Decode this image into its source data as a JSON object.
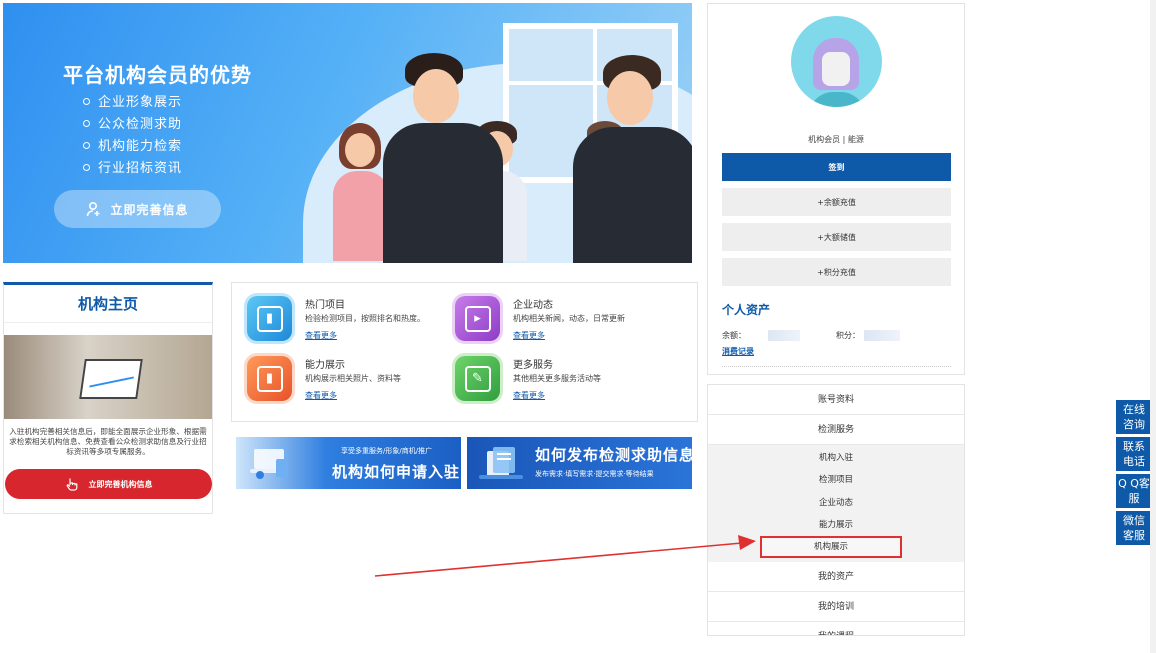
{
  "hero": {
    "title": "平台机构会员的优势",
    "points": [
      "企业形象展示",
      "公众检测求助",
      "机构能力检索",
      "行业招标资讯"
    ],
    "button": "立即完善信息"
  },
  "org_card": {
    "title": "机构主页",
    "description": "入驻机构完善相关信息后，即能全面展示企业形象、根据需求检索相关机构信息、免费查看公众检测求助信息及行业招标资讯等多项专属服务。",
    "button": "立即完善机构信息"
  },
  "services": [
    {
      "title": "热门项目",
      "desc": "检验检测项目，按照排名和热度。",
      "more": "查看更多",
      "icon": "book-icon",
      "color": "#29a3e6"
    },
    {
      "title": "企业动态",
      "desc": "机构相关新闻，动态，日常更新",
      "more": "查看更多",
      "icon": "video-icon",
      "color": "#a24fd1"
    },
    {
      "title": "能力展示",
      "desc": "机构展示相关照片、资料等",
      "more": "查看更多",
      "icon": "book-icon",
      "color": "#f06a3c"
    },
    {
      "title": "更多服务",
      "desc": "其他相关更多服务活动等",
      "more": "查看更多",
      "icon": "edit-icon",
      "color": "#3cb84a"
    }
  ],
  "promos": [
    {
      "sub": "享受多重服务/形象/商机/推广",
      "big": "机构如何申请入驻"
    },
    {
      "big": "如何发布检测求助信息",
      "sub": "发布需求·填写需求·提交需求·等待结果"
    }
  ],
  "profile": {
    "member_line": "机构会员 | 能源",
    "sign_in": "签到",
    "balance_recharge": "+余额充值",
    "large_deposit": "+大额储值",
    "points_recharge": "+积分充值",
    "assets_title": "个人资产",
    "balance_label": "余额：",
    "points_label": "积分：",
    "records_link": "消费记录"
  },
  "menu": {
    "account": "账号资料",
    "inspection": "检测服务",
    "sub_items": [
      "机构入驻",
      "检测项目",
      "企业动态",
      "能力展示",
      "机构展示"
    ],
    "highlighted_index": 4,
    "my_assets": "我的资产",
    "my_training": "我的培训",
    "my_courses": "我的课程"
  },
  "side_widget": [
    "在线咨询",
    "联系电话",
    "Q Q客服",
    "微信客服"
  ],
  "colors": {
    "primary": "#0e5aa8",
    "accent_red": "#d7262d",
    "highlight_box": "#e03131"
  }
}
